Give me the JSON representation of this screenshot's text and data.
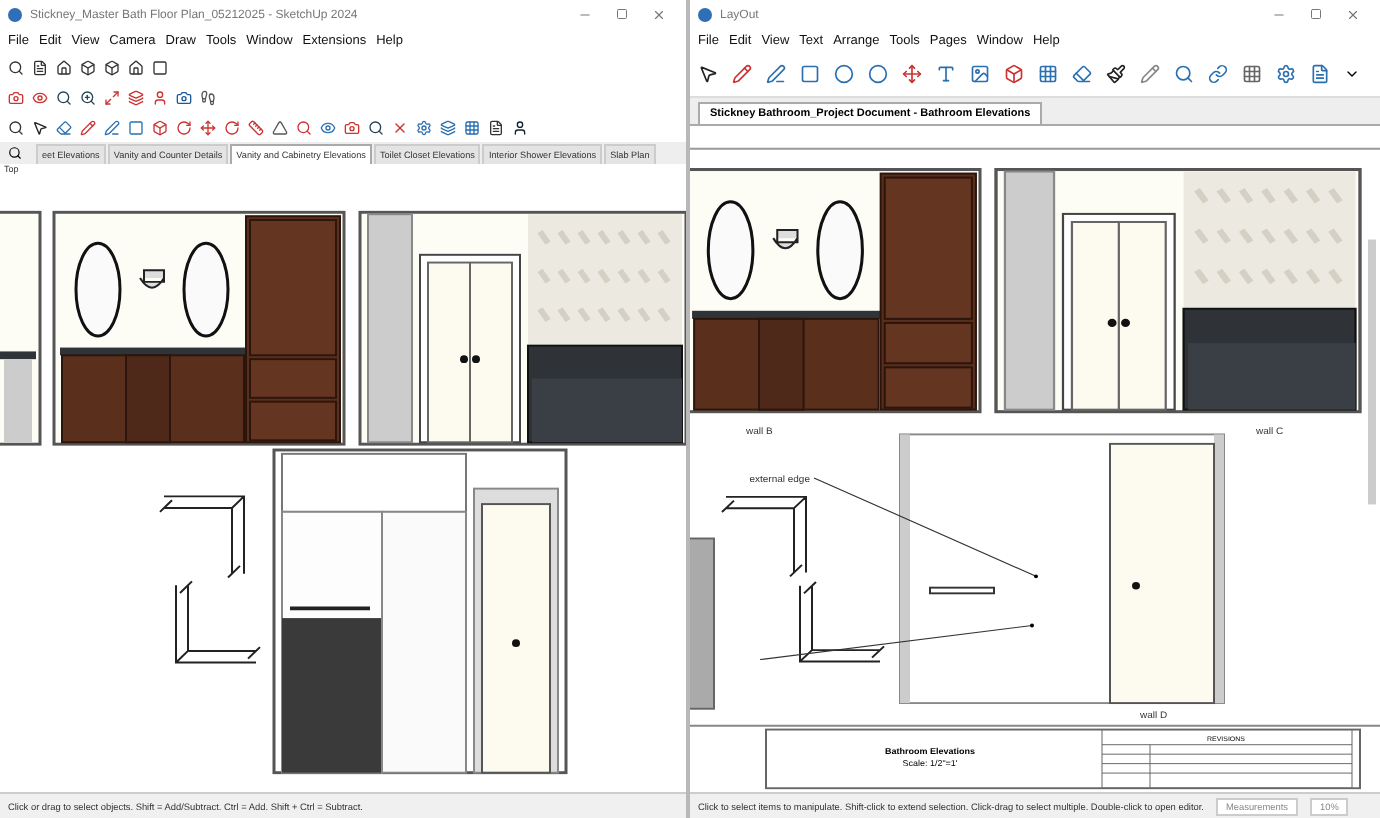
{
  "sketchup": {
    "title": "Stickney_Master Bath Floor Plan_05212025 - SketchUp 2024",
    "menu": [
      "File",
      "Edit",
      "View",
      "Camera",
      "Draw",
      "Tools",
      "Window",
      "Extensions",
      "Help"
    ],
    "tabs": [
      {
        "label": "eet Elevations",
        "selected": false
      },
      {
        "label": "Vanity and Counter Details",
        "selected": false
      },
      {
        "label": "Vanity and Cabinetry Elevations",
        "selected": true
      },
      {
        "label": "Toilet Closet Elevations",
        "selected": false
      },
      {
        "label": "Interior Shower Elevations",
        "selected": false
      },
      {
        "label": "Slab Plan",
        "selected": false
      }
    ],
    "view_label": "Top",
    "status": "Click or drag to select objects. Shift = Add/Subtract. Ctrl = Add. Shift + Ctrl = Subtract."
  },
  "layout": {
    "title": "LayOut",
    "menu": [
      "File",
      "Edit",
      "View",
      "Text",
      "Arrange",
      "Tools",
      "Pages",
      "Window",
      "Help"
    ],
    "document_tab": "Stickney Bathroom_Project Document - Bathroom Elevations",
    "wall_labels": [
      "wall B",
      "wall C",
      "wall D"
    ],
    "callout": "external edge",
    "title_block": {
      "title": "Bathroom Elevations",
      "scale": "Scale: 1/2\"=1'",
      "revisions": "REVISIONS"
    },
    "status": "Click to select items to manipulate. Shift-click to extend selection. Click-drag to select multiple. Double-click to open editor.",
    "measurements": "Measurements",
    "zoom": "10%"
  }
}
